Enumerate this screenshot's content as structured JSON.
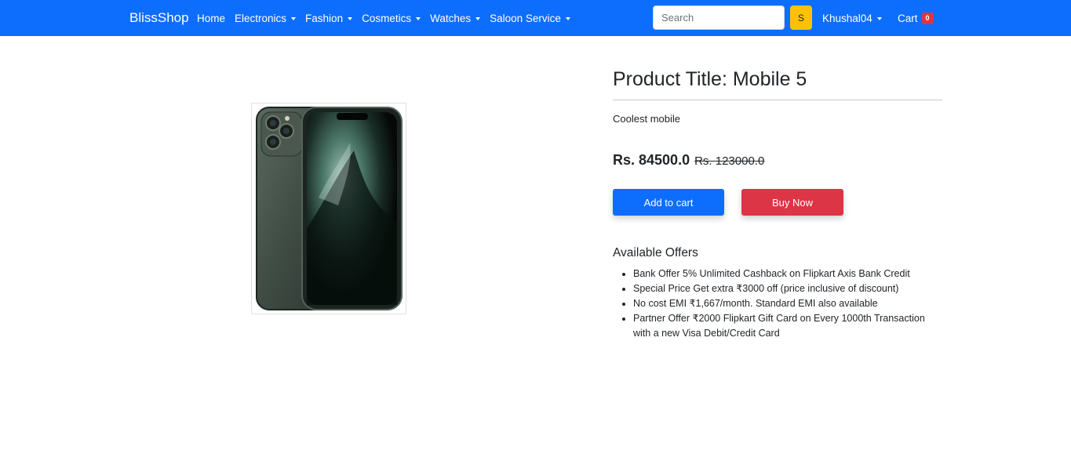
{
  "navbar": {
    "brand": "BlissShop",
    "items": [
      {
        "label": "Home",
        "dropdown": false
      },
      {
        "label": "Electronics",
        "dropdown": true
      },
      {
        "label": "Fashion",
        "dropdown": true
      },
      {
        "label": "Cosmetics",
        "dropdown": true
      },
      {
        "label": "Watches",
        "dropdown": true
      },
      {
        "label": "Saloon Service",
        "dropdown": true
      }
    ],
    "search_placeholder": "Search",
    "search_value": "",
    "search_button": "S",
    "user": "Khushal04",
    "cart_label": "Cart",
    "cart_count": "0"
  },
  "product": {
    "image_icon": "smartphone-image",
    "title": "Product Title: Mobile 5",
    "description": "Coolest mobile",
    "price": "Rs. 84500.0",
    "old_price": "Rs. 123000.0",
    "add_to_cart": "Add to cart",
    "buy_now": "Buy Now"
  },
  "offers": {
    "heading": "Available Offers",
    "items": [
      "Bank Offer 5% Unlimited Cashback on Flipkart Axis Bank Credit",
      "Special Price Get extra ₹3000 off (price inclusive of discount)",
      "No cost EMI ₹1,667/month. Standard EMI also available",
      "Partner Offer ₹2000 Flipkart Gift Card on Every 1000th Transaction with a new Visa Debit/Credit Card"
    ]
  },
  "colors": {
    "navbar": "#0d6efd",
    "search_button": "#ffc107",
    "cart_badge": "#dc3545",
    "add_to_cart": "#0d6efd",
    "buy_now": "#dc3545"
  }
}
